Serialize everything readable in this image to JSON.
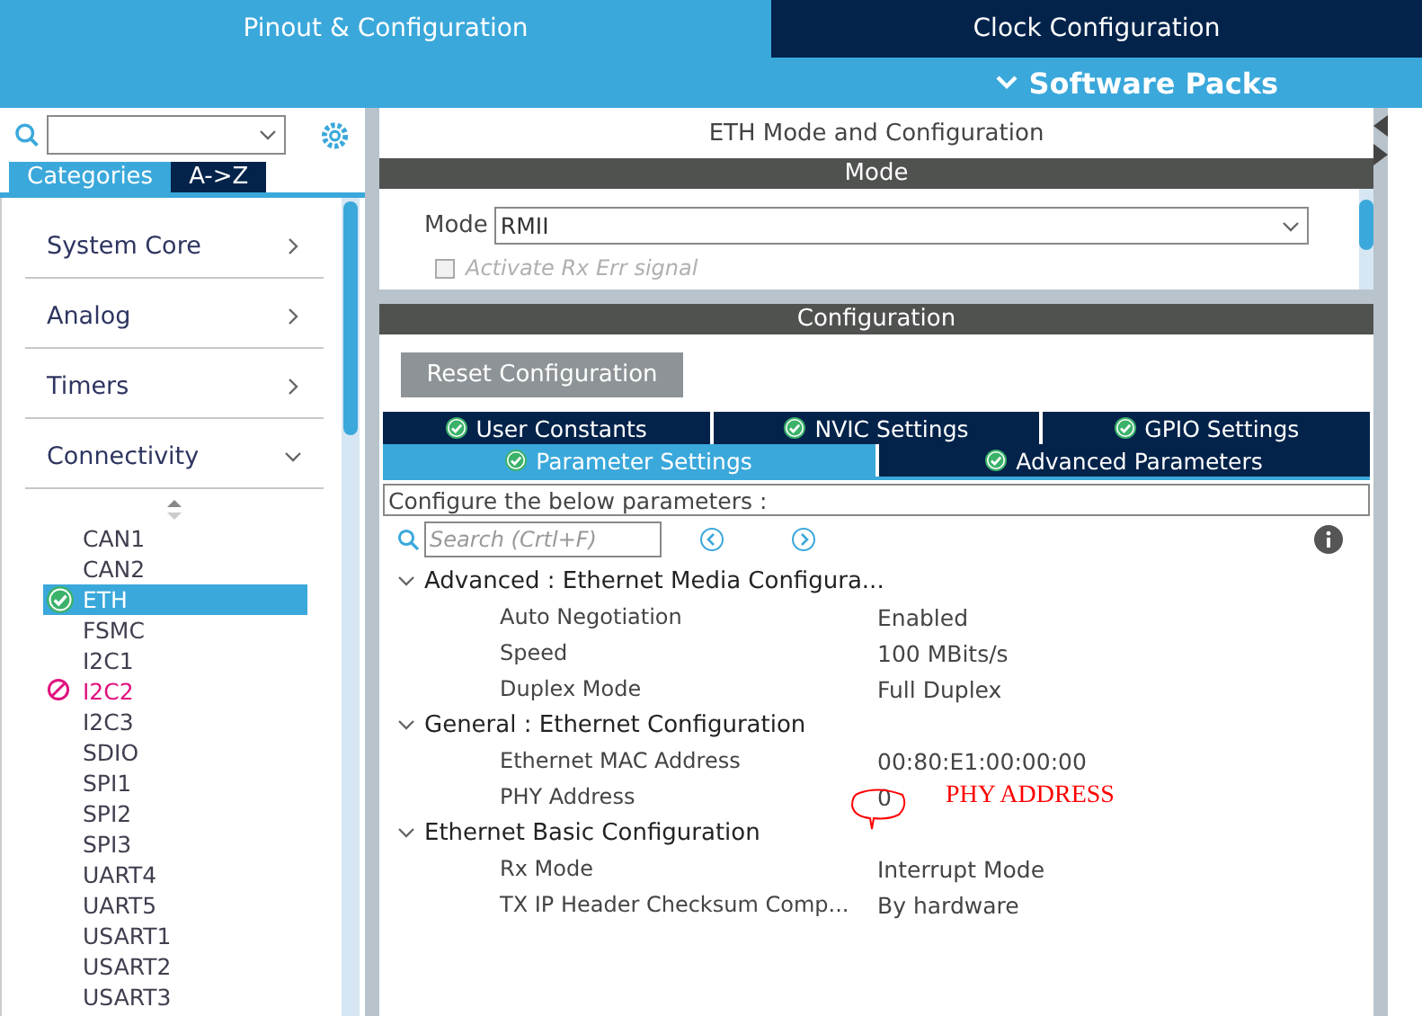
{
  "top_tabs": [
    {
      "label": "Pinout & Configuration",
      "selected": true
    },
    {
      "label": "Clock Configuration",
      "selected": false
    }
  ],
  "software_packs": {
    "label": "Software Packs"
  },
  "sidebar": {
    "tabs": [
      {
        "label": "Categories",
        "selected": true
      },
      {
        "label": "A->Z",
        "selected": false
      }
    ],
    "categories": [
      {
        "label": "System Core",
        "expanded": false
      },
      {
        "label": "Analog",
        "expanded": false
      },
      {
        "label": "Timers",
        "expanded": false
      },
      {
        "label": "Connectivity",
        "expanded": true,
        "children": [
          {
            "label": "CAN1",
            "kind": "plain",
            "selected": false
          },
          {
            "label": "CAN2",
            "kind": "plain",
            "selected": false
          },
          {
            "label": "ETH",
            "kind": "ok",
            "selected": true
          },
          {
            "label": "FSMC",
            "kind": "plain",
            "selected": false
          },
          {
            "label": "I2C1",
            "kind": "plain",
            "selected": false
          },
          {
            "label": "I2C2",
            "kind": "conflict",
            "selected": false
          },
          {
            "label": "I2C3",
            "kind": "plain",
            "selected": false
          },
          {
            "label": "SDIO",
            "kind": "plain",
            "selected": false
          },
          {
            "label": "SPI1",
            "kind": "plain",
            "selected": false
          },
          {
            "label": "SPI2",
            "kind": "plain",
            "selected": false
          },
          {
            "label": "SPI3",
            "kind": "plain",
            "selected": false
          },
          {
            "label": "UART4",
            "kind": "plain",
            "selected": false
          },
          {
            "label": "UART5",
            "kind": "plain",
            "selected": false
          },
          {
            "label": "USART1",
            "kind": "plain",
            "selected": false
          },
          {
            "label": "USART2",
            "kind": "plain",
            "selected": false
          },
          {
            "label": "USART3",
            "kind": "plain",
            "selected": false
          }
        ]
      }
    ]
  },
  "main": {
    "title": "ETH Mode and Configuration",
    "mode_section": {
      "header": "Mode",
      "label": "Mode",
      "value": "RMII",
      "checkbox": {
        "label": "Activate Rx Err signal",
        "checked": false,
        "disabled": true
      }
    },
    "config_section": {
      "header": "Configuration",
      "reset_button": "Reset Configuration",
      "tab_rows": [
        {
          "tabs": [
            {
              "label": "User Constants",
              "selected": false
            },
            {
              "label": "NVIC Settings",
              "selected": false
            },
            {
              "label": "GPIO Settings",
              "selected": false
            }
          ]
        },
        {
          "tabs": [
            {
              "label": "Parameter Settings",
              "selected": true
            },
            {
              "label": "Advanced Parameters",
              "selected": false
            }
          ]
        }
      ],
      "hint": "Configure the below parameters :",
      "search": {
        "placeholder": "Search (Crtl+F)"
      },
      "groups": [
        {
          "label": "Advanced : Ethernet Media Configura...",
          "expanded": true,
          "children": [
            {
              "name": "Auto Negotiation",
              "value": "Enabled"
            },
            {
              "name": "Speed",
              "value": "100 MBits/s"
            },
            {
              "name": "Duplex Mode",
              "value": "Full Duplex"
            }
          ]
        },
        {
          "label": "General : Ethernet Configuration",
          "expanded": true,
          "children": [
            {
              "name": "Ethernet MAC Address",
              "value": "00:80:E1:00:00:00"
            },
            {
              "name": "PHY Address",
              "value": "0",
              "annotation": "PHY  ADDRESS"
            }
          ]
        },
        {
          "label": "Ethernet Basic Configuration",
          "expanded": true,
          "children": [
            {
              "name": "Rx Mode",
              "value": "Interrupt Mode"
            },
            {
              "name": "TX IP Header Checksum Comp...",
              "value": "By hardware"
            }
          ]
        }
      ]
    }
  }
}
